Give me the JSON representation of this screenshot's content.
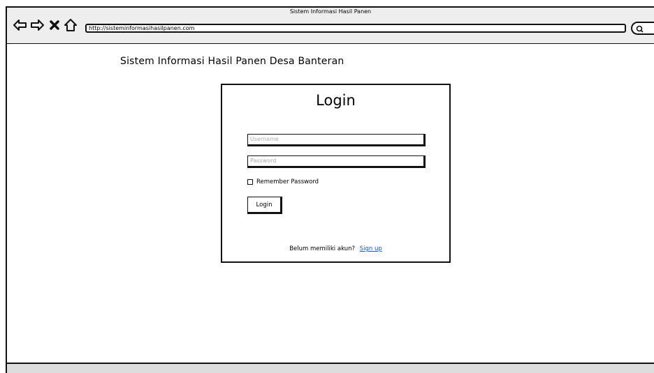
{
  "browser": {
    "title": "Sistem Informasi Hasil Panen",
    "url": "http://sisteminformasihasilpanen.com",
    "icons": [
      "back-arrow-icon",
      "forward-arrow-icon",
      "close-icon",
      "home-icon",
      "search-icon"
    ]
  },
  "page": {
    "heading": "Sistem Informasi Hasil Panen Desa Banteran"
  },
  "login": {
    "title": "Login",
    "username_placeholder": "Username",
    "password_placeholder": "Password",
    "remember_label": "Remember Password",
    "button_label": "Login",
    "signup_prompt": "Belum memiliki akun?",
    "signup_link": "Sign up"
  }
}
